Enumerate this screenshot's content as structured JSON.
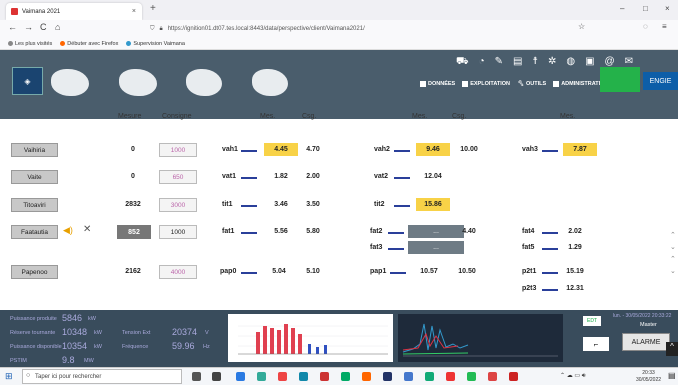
{
  "browser": {
    "tab_title": "Vaimana 2021",
    "tab_close": "×",
    "new_tab": "+",
    "window_controls": [
      "–",
      "□",
      "×"
    ],
    "url": "https://ignition01.dt07.tes.local:8443/data/perspective/client/Vaimana2021/",
    "nav": {
      "back": "←",
      "forward": "→",
      "reload": "C",
      "home": "⌂"
    },
    "bookmarks": [
      "Les plus visités",
      "Débuter avec Firefox",
      "Supervision Vaimana"
    ]
  },
  "header": {
    "menu": [
      "DONNÉES",
      "EXPLOITATION",
      "OUTILS",
      "ADMINISTRATION"
    ],
    "tool_icons": [
      "car-icon",
      "bell-icon",
      "pencil-icon",
      "file-icon",
      "person-icon",
      "settings-icon",
      "globe-icon",
      "help-icon",
      "at-icon",
      "mail-icon"
    ],
    "brand": "ENGIE"
  },
  "columns": {
    "mesure": "Mesure",
    "consigne": "Consigne",
    "mes1": "Mes.",
    "csg1": "Csg.",
    "mes2": "Mes.",
    "csg2": "Csg.",
    "mes3": "Mes."
  },
  "sites": [
    {
      "name": "Vaihiria",
      "mesure": "0",
      "consigne": "1000"
    },
    {
      "name": "Vaite",
      "mesure": "0",
      "consigne": "650"
    },
    {
      "name": "Titoaviri",
      "mesure": "2832",
      "consigne": "3000"
    },
    {
      "name": "Faatautia",
      "mesure": "852",
      "consigne": "1000"
    },
    {
      "name": "Papenoo",
      "mesure": "2162",
      "consigne": "4000"
    }
  ],
  "groups": {
    "vah1": {
      "tag": "vah1",
      "mes": "4.45",
      "csg": "4.70"
    },
    "vah2": {
      "tag": "vah2",
      "mes": "9.46",
      "csg": "10.00"
    },
    "vah3": {
      "tag": "vah3",
      "mes": "7.87"
    },
    "vat1": {
      "tag": "vat1",
      "mes": "1.82",
      "csg": "2.00"
    },
    "vat2": {
      "tag": "vat2",
      "mes": "12.04"
    },
    "tit1": {
      "tag": "tit1",
      "mes": "3.46",
      "csg": "3.50"
    },
    "tit2": {
      "tag": "tit2",
      "mes": "15.86"
    },
    "fat1": {
      "tag": "fat1",
      "mes": "5.56",
      "csg": "5.80"
    },
    "fat2": {
      "tag": "fat2",
      "mes": "...",
      "csg": "4.40"
    },
    "fat3": {
      "tag": "fat3",
      "mes": "..."
    },
    "fat4": {
      "tag": "fat4",
      "mes": "2.02"
    },
    "fat5": {
      "tag": "fat5",
      "mes": "1.29"
    },
    "pap0": {
      "tag": "pap0",
      "mes": "5.04",
      "csg": "5.10"
    },
    "pap1": {
      "tag": "pap1",
      "mes": "10.57",
      "csg": "10.50"
    },
    "p2t1": {
      "tag": "p2t1",
      "mes": "15.19"
    },
    "p2t3": {
      "tag": "p2t3",
      "mes": "12.31"
    }
  },
  "footer": {
    "puissance_produite_label": "Puissance produite",
    "puissance_produite_value": "5846",
    "puissance_produite_unit": "kW",
    "reserve_label": "Réserve tournante",
    "reserve_value": "10348",
    "reserve_unit": "kW",
    "tension_label": "Tension Ext",
    "tension_value": "20374",
    "tension_unit": "V",
    "dispo_label": "Puissance disponible",
    "dispo_value": "10354",
    "dispo_unit": "kW",
    "freq_label": "Fréquence",
    "freq_value": "59.96",
    "freq_unit": "Hz",
    "pstim_label": "PSTIM",
    "pstim_value": "9.8",
    "pstim_unit": "MW",
    "edt_logo": "EDT",
    "datetime": "lun. - 30/05/2022 20:33:22",
    "user": "Master",
    "alarm": "ALARME"
  },
  "taskbar": {
    "search_placeholder": "Taper ici pour rechercher",
    "time": "20:33",
    "date": "30/05/2022"
  },
  "colors": {
    "highlight": "#f8d247",
    "header": "#4a5d6c",
    "footer": "#394c5c",
    "line": "#2a3f9a"
  }
}
